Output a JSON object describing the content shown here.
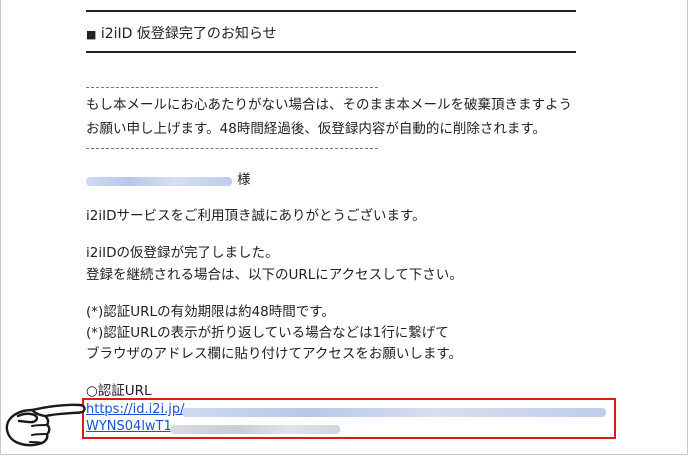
{
  "email": {
    "subject_marker": "■",
    "subject": "i2iID 仮登録完了のお知らせ",
    "notice_line1": "もし本メールにお心あたりがない場合は、そのまま本メールを破棄頂きますよう",
    "notice_line2": "お願い申し上げます。48時間経過後、仮登録内容が自動的に削除されます。",
    "recipient_suffix": "様",
    "thanks": "i2iIDサービスをご利用頂き誠にありがとうございます。",
    "body_line1": "i2iIDの仮登録が完了しました。",
    "body_line2": "登録を継続される場合は、以下のURLにアクセスして下さい。",
    "note1": "(*)認証URLの有効期限は約48時間です。",
    "note2": "(*)認証URLの表示が折り返している場合などは1行に繋げて",
    "note3": "ブラウザのアドレス欄に貼り付けてアクセスをお願いします。",
    "url_label": "○認証URL",
    "url_part1": "https://id.i2i.jp/",
    "url_part2": "WYNS04lwT1"
  },
  "colors": {
    "highlight_box": "#e0181b",
    "link": "#1a4fd6"
  },
  "icons": {
    "pointer": "pointing-hand-icon"
  }
}
